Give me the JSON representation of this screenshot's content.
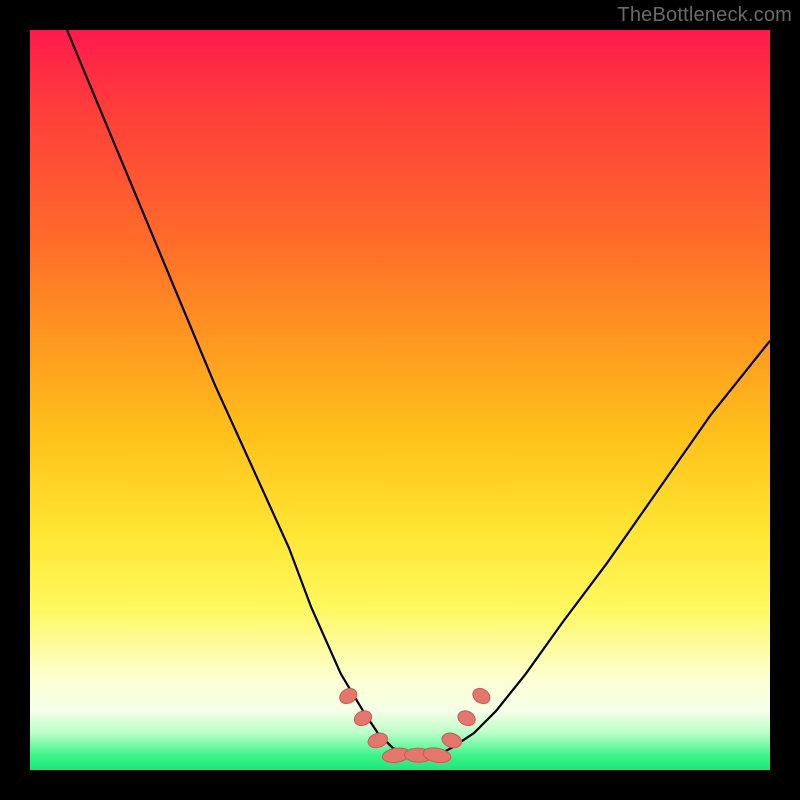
{
  "watermark": "TheBottleneck.com",
  "colors": {
    "frame": "#000000",
    "gradient_top": "#ff1a4d",
    "gradient_mid1": "#ff9820",
    "gradient_mid2": "#ffe633",
    "gradient_bottom": "#18e87a",
    "curve": "#000000",
    "marker_fill": "#e4766d",
    "marker_stroke": "#c95b52"
  },
  "chart_data": {
    "type": "line",
    "title": "",
    "xlabel": "",
    "ylabel": "",
    "xlim": [
      0,
      100
    ],
    "ylim": [
      0,
      100
    ],
    "series": [
      {
        "name": "bottleneck-curve",
        "x": [
          5,
          10,
          15,
          20,
          25,
          30,
          35,
          38,
          42,
          45,
          47,
          49,
          51,
          53,
          55,
          57,
          60,
          63,
          67,
          72,
          78,
          85,
          92,
          100
        ],
        "y": [
          100,
          88,
          76,
          64,
          52,
          41,
          30,
          22,
          13,
          8,
          5,
          3,
          2,
          2,
          2,
          3,
          5,
          8,
          13,
          20,
          28,
          38,
          48,
          58
        ]
      }
    ],
    "markers": {
      "name": "highlight-points",
      "x": [
        43,
        45,
        47,
        49.5,
        52.5,
        55,
        57,
        59,
        61
      ],
      "y": [
        10,
        7,
        4,
        2,
        2,
        2,
        4,
        7,
        10
      ]
    }
  }
}
